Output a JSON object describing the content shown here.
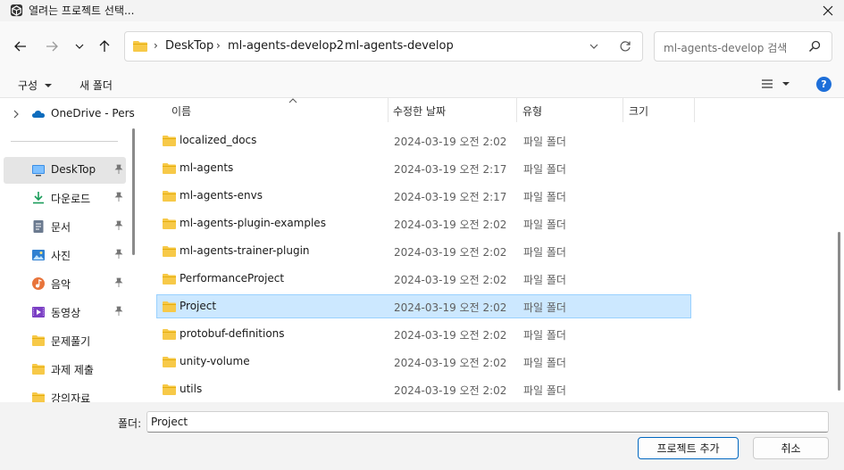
{
  "window": {
    "title": "열려는 프로젝트 선택..."
  },
  "address_bar": {
    "crumbs": [
      "DeskTop",
      "ml-agents-develop2",
      "ml-agents-develop"
    ]
  },
  "search": {
    "placeholder": "ml-agents-develop 검색"
  },
  "command_bar": {
    "organize_label": "구성",
    "new_folder_label": "새 폴더",
    "help_label": "?"
  },
  "sidebar": {
    "onedrive_label": "OneDrive - Pers",
    "items": [
      {
        "label": "DeskTop",
        "icon": "desktop-icon",
        "pinned": true,
        "selected": true
      },
      {
        "label": "다운로드",
        "icon": "download-icon",
        "pinned": true
      },
      {
        "label": "문서",
        "icon": "document-icon",
        "pinned": true
      },
      {
        "label": "사진",
        "icon": "picture-icon",
        "pinned": true
      },
      {
        "label": "음악",
        "icon": "music-icon",
        "pinned": true
      },
      {
        "label": "동영상",
        "icon": "video-icon",
        "pinned": true
      },
      {
        "label": "문제풀기",
        "icon": "folder-icon",
        "pinned": false
      },
      {
        "label": "과제 제출",
        "icon": "folder-icon",
        "pinned": false
      },
      {
        "label": "강의자료",
        "icon": "folder-icon",
        "pinned": false
      }
    ]
  },
  "file_list": {
    "columns": {
      "name": "이름",
      "date": "수정한 날짜",
      "type": "유형",
      "size": "크기"
    },
    "rows": [
      {
        "name": "localized_docs",
        "date": "2024-03-19 오전 2:02",
        "type": "파일 폴더"
      },
      {
        "name": "ml-agents",
        "date": "2024-03-19 오전 2:17",
        "type": "파일 폴더"
      },
      {
        "name": "ml-agents-envs",
        "date": "2024-03-19 오전 2:17",
        "type": "파일 폴더"
      },
      {
        "name": "ml-agents-plugin-examples",
        "date": "2024-03-19 오전 2:02",
        "type": "파일 폴더"
      },
      {
        "name": "ml-agents-trainer-plugin",
        "date": "2024-03-19 오전 2:02",
        "type": "파일 폴더"
      },
      {
        "name": "PerformanceProject",
        "date": "2024-03-19 오전 2:02",
        "type": "파일 폴더"
      },
      {
        "name": "Project",
        "date": "2024-03-19 오전 2:02",
        "type": "파일 폴더",
        "selected": true
      },
      {
        "name": "protobuf-definitions",
        "date": "2024-03-19 오전 2:02",
        "type": "파일 폴더"
      },
      {
        "name": "unity-volume",
        "date": "2024-03-19 오전 2:02",
        "type": "파일 폴더"
      },
      {
        "name": "utils",
        "date": "2024-03-19 오전 2:02",
        "type": "파일 폴더"
      }
    ]
  },
  "footer": {
    "folder_label": "폴더:",
    "folder_value": "Project",
    "select_button": "프로젝트 추가",
    "cancel_button": "취소"
  },
  "colors": {
    "folder": "#f7c948",
    "selection": "#cce8ff",
    "accent": "#0067c0"
  }
}
